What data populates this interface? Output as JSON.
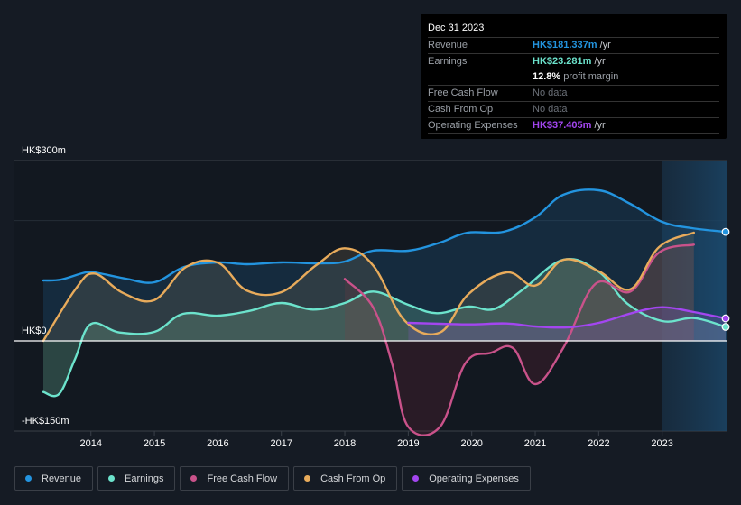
{
  "tooltip": {
    "date": "Dec 31 2023",
    "rows": [
      {
        "label": "Revenue",
        "value": "HK$181.337m",
        "unit": "/yr",
        "color": "#2394df"
      },
      {
        "label": "Earnings",
        "value": "HK$23.281m",
        "unit": "/yr",
        "color": "#6ce3cc"
      },
      {
        "label": "",
        "value": "12.8%",
        "unit": "profit margin",
        "color": "#ffffff"
      },
      {
        "label": "Free Cash Flow",
        "value": "No data",
        "unit": "",
        "color": "#6b7078"
      },
      {
        "label": "Cash From Op",
        "value": "No data",
        "unit": "",
        "color": "#6b7078"
      },
      {
        "label": "Operating Expenses",
        "value": "HK$37.405m",
        "unit": "/yr",
        "color": "#a346f0"
      }
    ]
  },
  "legend": [
    {
      "label": "Revenue",
      "color": "#2394df"
    },
    {
      "label": "Earnings",
      "color": "#6ce3cc"
    },
    {
      "label": "Free Cash Flow",
      "color": "#c9528a"
    },
    {
      "label": "Cash From Op",
      "color": "#e8ab5b"
    },
    {
      "label": "Operating Expenses",
      "color": "#a346f0"
    }
  ],
  "chart_data": {
    "type": "area",
    "title": "",
    "xlabel": "",
    "ylabel": "",
    "ylim": [
      -150,
      300
    ],
    "y_ticks": [
      {
        "value": 300,
        "label": "HK$300m"
      },
      {
        "value": 0,
        "label": "HK$0"
      },
      {
        "value": -150,
        "label": "-HK$150m"
      }
    ],
    "x_ticks": [
      2014,
      2015,
      2016,
      2017,
      2018,
      2019,
      2020,
      2021,
      2022,
      2023
    ],
    "xlim": [
      2013.25,
      2024.0
    ],
    "forecast_start": 2023.0,
    "grid": true,
    "legend_position": "bottom-left",
    "series": [
      {
        "name": "Revenue",
        "color": "#2394df",
        "end_marker": true,
        "points": [
          [
            2013.25,
            100.5
          ],
          [
            2013.53,
            102
          ],
          [
            2013.92,
            114
          ],
          [
            2014.13,
            112.5
          ],
          [
            2014.55,
            103.5
          ],
          [
            2015.0,
            97.5
          ],
          [
            2015.47,
            123
          ],
          [
            2016.0,
            130.5
          ],
          [
            2016.46,
            127.5
          ],
          [
            2017.0,
            130.5
          ],
          [
            2017.6,
            129
          ],
          [
            2018.0,
            132
          ],
          [
            2018.44,
            150
          ],
          [
            2019.0,
            150
          ],
          [
            2019.5,
            163.5
          ],
          [
            2019.93,
            180
          ],
          [
            2020.5,
            181.5
          ],
          [
            2021.0,
            205.5
          ],
          [
            2021.44,
            243
          ],
          [
            2022.0,
            250.5
          ],
          [
            2022.47,
            229.5
          ],
          [
            2023.0,
            198
          ],
          [
            2023.47,
            187.5
          ],
          [
            2024.0,
            181.3
          ]
        ]
      },
      {
        "name": "Earnings",
        "color": "#6ce3cc",
        "end_marker": true,
        "points": [
          [
            2013.25,
            -85
          ],
          [
            2013.5,
            -88
          ],
          [
            2013.75,
            -30
          ],
          [
            2014.0,
            28
          ],
          [
            2014.45,
            14
          ],
          [
            2015.0,
            15
          ],
          [
            2015.45,
            45
          ],
          [
            2016.0,
            42
          ],
          [
            2016.5,
            50
          ],
          [
            2017.0,
            63
          ],
          [
            2017.5,
            52
          ],
          [
            2018.0,
            63
          ],
          [
            2018.45,
            82
          ],
          [
            2019.0,
            60
          ],
          [
            2019.45,
            46
          ],
          [
            2019.95,
            57
          ],
          [
            2020.35,
            53
          ],
          [
            2020.8,
            85
          ],
          [
            2021.44,
            135
          ],
          [
            2022.0,
            115
          ],
          [
            2022.45,
            62
          ],
          [
            2023.0,
            33
          ],
          [
            2023.5,
            38
          ],
          [
            2024.0,
            23.3
          ]
        ]
      },
      {
        "name": "Free Cash Flow",
        "color": "#c9528a",
        "end_marker": false,
        "points": [
          [
            2018.0,
            103
          ],
          [
            2018.45,
            55
          ],
          [
            2018.75,
            -40
          ],
          [
            2019.0,
            -143
          ],
          [
            2019.5,
            -143
          ],
          [
            2019.9,
            -37
          ],
          [
            2020.3,
            -20
          ],
          [
            2020.65,
            -12
          ],
          [
            2021.0,
            -72
          ],
          [
            2021.45,
            -10
          ],
          [
            2021.95,
            95
          ],
          [
            2022.5,
            82
          ],
          [
            2022.95,
            147
          ],
          [
            2023.5,
            160
          ]
        ]
      },
      {
        "name": "Cash From Op",
        "color": "#e8ab5b",
        "end_marker": false,
        "points": [
          [
            2013.25,
            0
          ],
          [
            2013.75,
            85
          ],
          [
            2014.05,
            112
          ],
          [
            2014.5,
            80
          ],
          [
            2015.0,
            68
          ],
          [
            2015.5,
            123
          ],
          [
            2016.0,
            130
          ],
          [
            2016.45,
            84
          ],
          [
            2017.0,
            81
          ],
          [
            2017.55,
            126
          ],
          [
            2018.0,
            154
          ],
          [
            2018.45,
            125
          ],
          [
            2018.95,
            33
          ],
          [
            2019.5,
            14
          ],
          [
            2019.95,
            78
          ],
          [
            2020.55,
            114
          ],
          [
            2021.0,
            92
          ],
          [
            2021.45,
            135
          ],
          [
            2022.0,
            116
          ],
          [
            2022.5,
            86
          ],
          [
            2022.95,
            156
          ],
          [
            2023.5,
            180
          ]
        ]
      },
      {
        "name": "Operating Expenses",
        "color": "#a346f0",
        "end_marker": true,
        "points": [
          [
            2019.0,
            30
          ],
          [
            2019.5,
            28.5
          ],
          [
            2020.0,
            27.5
          ],
          [
            2020.55,
            29
          ],
          [
            2021.0,
            24
          ],
          [
            2021.5,
            22.5
          ],
          [
            2022.0,
            30
          ],
          [
            2022.55,
            47
          ],
          [
            2023.0,
            56
          ],
          [
            2023.5,
            48
          ],
          [
            2024.0,
            37.4
          ]
        ]
      }
    ]
  }
}
